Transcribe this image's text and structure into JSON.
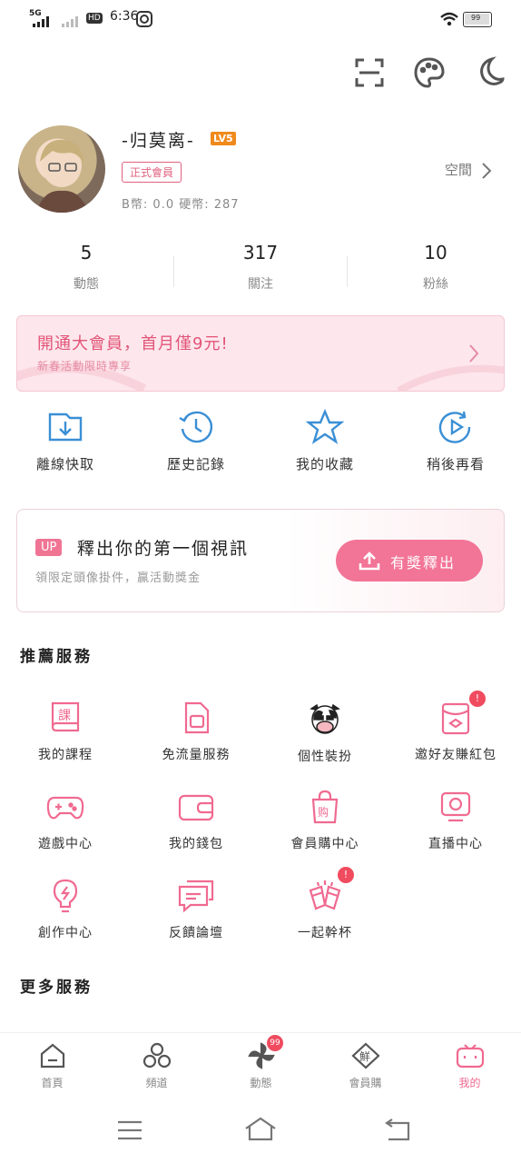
{
  "status": {
    "network": "5G",
    "hd": "HD",
    "time": "6:36",
    "battery": "99"
  },
  "profile": {
    "username": "-归莫离-",
    "level": "LV5",
    "vip_badge": "正式會員",
    "coins": "B幣: 0.0   硬幣: 287",
    "space_link": "空間"
  },
  "stats": [
    {
      "num": "5",
      "label": "動態"
    },
    {
      "num": "317",
      "label": "關注"
    },
    {
      "num": "10",
      "label": "粉絲"
    }
  ],
  "vip_banner": {
    "title": "開通大會員，首月僅9元!",
    "subtitle": "新春活動限時專享"
  },
  "quick_actions": [
    {
      "label": "離線快取",
      "icon": "download-icon"
    },
    {
      "label": "歷史記錄",
      "icon": "history-icon"
    },
    {
      "label": "我的收藏",
      "icon": "star-icon"
    },
    {
      "label": "稍後再看",
      "icon": "watch-later-icon"
    }
  ],
  "upload_card": {
    "tag": "UP",
    "title": "釋出你的第一個視訊",
    "subtitle": "領限定頭像掛件，贏活動獎金",
    "button": "有獎釋出"
  },
  "recommended": {
    "title": "推薦服務",
    "items": [
      {
        "label": "我的課程",
        "icon": "course-icon"
      },
      {
        "label": "免流量服務",
        "icon": "sim-card-icon"
      },
      {
        "label": "個性裝扮",
        "icon": "avatar-cow-icon"
      },
      {
        "label": "邀好友賺紅包",
        "icon": "red-packet-icon",
        "badge": "!"
      },
      {
        "label": "遊戲中心",
        "icon": "gamepad-icon"
      },
      {
        "label": "我的錢包",
        "icon": "wallet-icon"
      },
      {
        "label": "會員購中心",
        "icon": "shopping-bag-icon"
      },
      {
        "label": "直播中心",
        "icon": "live-tv-icon"
      },
      {
        "label": "創作中心",
        "icon": "lightbulb-icon"
      },
      {
        "label": "反饋論壇",
        "icon": "chat-icon"
      },
      {
        "label": "一起幹杯",
        "icon": "cheers-icon",
        "badge": "!"
      }
    ]
  },
  "more": {
    "title": "更多服務"
  },
  "bottom_nav": [
    {
      "label": "首頁",
      "icon": "home-icon"
    },
    {
      "label": "頻道",
      "icon": "channels-icon"
    },
    {
      "label": "動態",
      "icon": "pinwheel-icon",
      "badge": "99"
    },
    {
      "label": "會員購",
      "icon": "vip-shop-icon"
    },
    {
      "label": "我的",
      "icon": "tv-mine-icon",
      "active": true
    }
  ],
  "colors": {
    "accent": "#f06a90",
    "pink_bg": "#fde7ec",
    "badge_red": "#f04b5f"
  }
}
